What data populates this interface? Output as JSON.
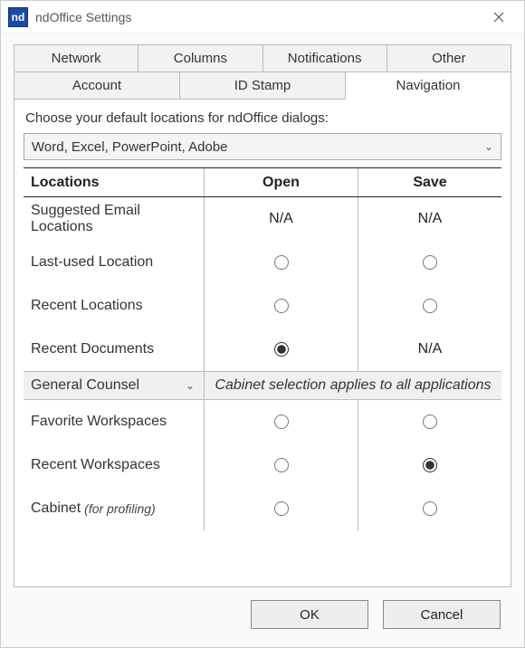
{
  "window": {
    "title": "ndOffice Settings",
    "logo_text": "nd"
  },
  "tabs": {
    "row1": [
      "Network",
      "Columns",
      "Notifications",
      "Other"
    ],
    "row2": [
      "Account",
      "ID Stamp",
      "Navigation"
    ],
    "active": "Navigation"
  },
  "navigation": {
    "intro": "Choose your default locations for ndOffice dialogs:",
    "app_selector": {
      "value": "Word, Excel, PowerPoint, Adobe"
    },
    "columns": {
      "loc": "Locations",
      "open": "Open",
      "save": "Save"
    },
    "rows": {
      "suggested": {
        "label": "Suggested Email Locations",
        "open": "na",
        "save": "na"
      },
      "lastused": {
        "label": "Last-used Location",
        "open": "radio",
        "save": "radio"
      },
      "recentloc": {
        "label": "Recent Locations",
        "open": "radio",
        "save": "radio"
      },
      "recentdoc": {
        "label": "Recent Documents",
        "open": "radio-checked",
        "save": "na"
      },
      "favws": {
        "label": "Favorite Workspaces",
        "open": "radio",
        "save": "radio"
      },
      "recws": {
        "label": "Recent Workspaces",
        "open": "radio",
        "save": "radio-checked"
      },
      "cabinet": {
        "label": "Cabinet",
        "note": "(for profiling)",
        "open": "radio",
        "save": "radio"
      }
    },
    "na_text": "N/A",
    "cabinet_selector": {
      "value": "General Counsel"
    },
    "cabinet_hint": "Cabinet selection applies to all applications"
  },
  "buttons": {
    "ok": "OK",
    "cancel": "Cancel"
  }
}
